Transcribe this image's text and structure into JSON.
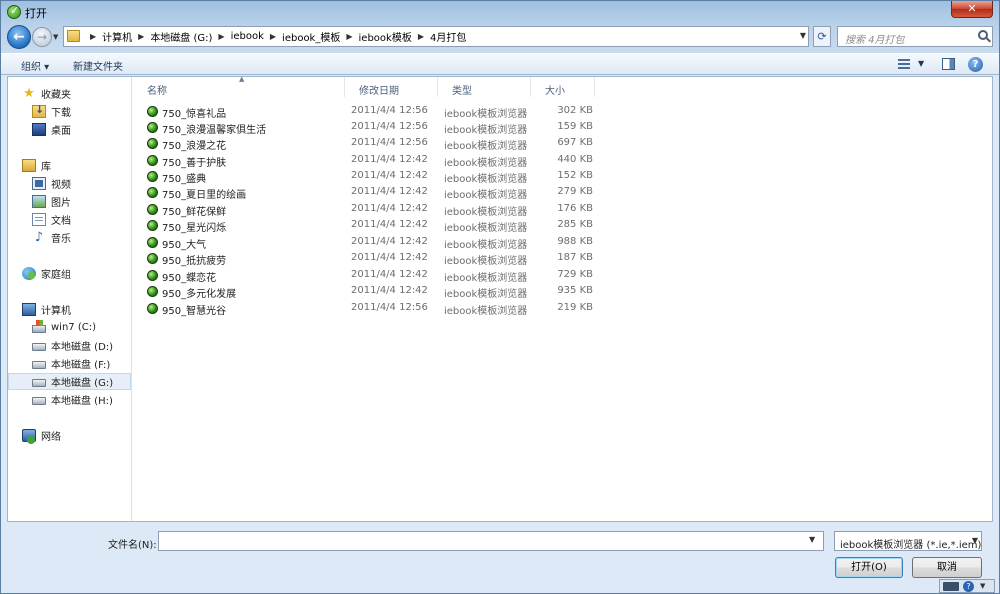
{
  "window": {
    "title": "打开"
  },
  "address": {
    "crumbs": [
      "计算机",
      "本地磁盘 (G:)",
      "iebook",
      "iebook_模板",
      "iebook模板",
      "4月打包"
    ]
  },
  "search": {
    "placeholder": "搜索 4月打包"
  },
  "toolbar": {
    "organize_label": "组织 ▾",
    "newfolder_label": "新建文件夹"
  },
  "nav": {
    "favorites": "收藏夹",
    "downloads": "下载",
    "desktop": "桌面",
    "libraries": "库",
    "videos": "视频",
    "pictures": "图片",
    "documents": "文档",
    "music": "音乐",
    "homegroup": "家庭组",
    "computer": "计算机",
    "drive_c": "win7 (C:)",
    "drive_d": "本地磁盘 (D:)",
    "drive_f": "本地磁盘 (F:)",
    "drive_g": "本地磁盘 (G:)",
    "drive_h": "本地磁盘 (H:)",
    "network": "网络"
  },
  "columns": {
    "name": "名称",
    "date": "修改日期",
    "type": "类型",
    "size": "大小"
  },
  "files": [
    {
      "name": "750_惊喜礼品",
      "date": "2011/4/4 12:56",
      "type": "iebook模板浏览器",
      "size": "302 KB"
    },
    {
      "name": "750_浪漫温馨家俱生活",
      "date": "2011/4/4 12:56",
      "type": "iebook模板浏览器",
      "size": "159 KB"
    },
    {
      "name": "750_浪漫之花",
      "date": "2011/4/4 12:56",
      "type": "iebook模板浏览器",
      "size": "697 KB"
    },
    {
      "name": "750_善于护肤",
      "date": "2011/4/4 12:42",
      "type": "iebook模板浏览器",
      "size": "440 KB"
    },
    {
      "name": "750_盛典",
      "date": "2011/4/4 12:42",
      "type": "iebook模板浏览器",
      "size": "152 KB"
    },
    {
      "name": "750_夏日里的绘画",
      "date": "2011/4/4 12:42",
      "type": "iebook模板浏览器",
      "size": "279 KB"
    },
    {
      "name": "750_鲜花保鲜",
      "date": "2011/4/4 12:42",
      "type": "iebook模板浏览器",
      "size": "176 KB"
    },
    {
      "name": "750_星光闪烁",
      "date": "2011/4/4 12:42",
      "type": "iebook模板浏览器",
      "size": "285 KB"
    },
    {
      "name": "950_大气",
      "date": "2011/4/4 12:42",
      "type": "iebook模板浏览器",
      "size": "988 KB"
    },
    {
      "name": "950_抵抗疲劳",
      "date": "2011/4/4 12:42",
      "type": "iebook模板浏览器",
      "size": "187 KB"
    },
    {
      "name": "950_蝶恋花",
      "date": "2011/4/4 12:42",
      "type": "iebook模板浏览器",
      "size": "729 KB"
    },
    {
      "name": "950_多元化发展",
      "date": "2011/4/4 12:42",
      "type": "iebook模板浏览器",
      "size": "935 KB"
    },
    {
      "name": "950_智慧光谷",
      "date": "2011/4/4 12:56",
      "type": "iebook模板浏览器",
      "size": "219 KB"
    }
  ],
  "bottom": {
    "filename_label": "文件名(N):",
    "filename_value": "",
    "filter_value": "iebook模板浏览器 (*.ie,*.iem)",
    "open_label": "打开(O)",
    "cancel_label": "取消"
  }
}
